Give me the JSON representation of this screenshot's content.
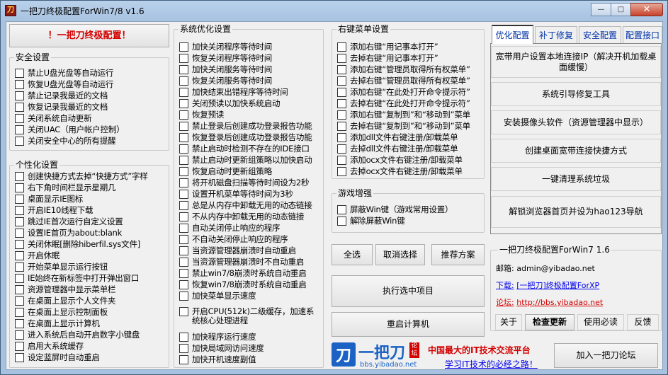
{
  "window": {
    "title": "一把刀终极配置ForWin7/8 v1.6",
    "app_icon_glyph": "刀",
    "minimize": "—",
    "maximize": "□",
    "close": "✕"
  },
  "left": {
    "top_button": "！一把刀终极配置！",
    "security": {
      "title": "安全设置",
      "items": [
        "禁止U盘光盘等自动运行",
        "恢复U盘光盘等自动运行",
        "禁止记录我最近的文档",
        "恢复记录我最近的文档",
        "关闭系统自动更新",
        "关闭UAC（用户帐户控制）",
        "关闭安全中心的所有提醒"
      ]
    },
    "personal": {
      "title": "个性化设置",
      "items": [
        "创建快捷方式去掉“快捷方式”字样",
        "右下角时间栏显示星期几",
        "桌面显示IE图标",
        "开启IE10线程下载",
        "跳过IE首次运行自定义设置",
        "设置IE首页为about:blank",
        "关闭休眠[删除hiberfil.sys文件]",
        "开启休眠",
        "开始菜单显示运行按钮",
        "IE始终在新标签中打开弹出窗口",
        "资源管理器中显示菜单栏",
        "在桌面上显示个人文件夹",
        "在桌面上显示控制面板",
        "在桌面上显示计算机",
        "进入系统后自动开启数字小键盘",
        "启用大系统缓存",
        "设定蓝屏时自动重启"
      ]
    }
  },
  "middle": {
    "title": "系统优化设置",
    "items": [
      "加快关闭程序等待时间",
      "恢复关闭程序等待时间",
      "加快关闭服务等待时间",
      "恢复关闭服务等待时间",
      "加快结束出错程序等待时间",
      "关闭预读以加快系统启动",
      "恢复预读",
      "禁止登录后创建成功登录报告功能",
      "恢复登录后创建成功登录报告功能",
      "禁止启动时检测不存在的IDE接口",
      "禁止启动时更新组策略以加快启动",
      "恢复启动时更新组策略",
      "将开机磁盘扫描等待时间设为2秒",
      "设置开机菜单等待时间为3秒",
      "总是从内存中卸载无用的动态链接",
      "不从内存中卸载无用的动态链接",
      "自动关闭停止响应的程序",
      "不自动关闭停止响应的程序",
      "当资源管理器崩溃时自动重启",
      "当资源管理器崩溃时不自动重启",
      "禁止win7/8崩溃时系统自动重启",
      "恢复win7/8崩溃时系统自动重启",
      "加快菜单显示速度"
    ],
    "cpu_item": "开启CPU(512k)二级缓存，加速系统核心处理进程",
    "items2": [
      "加快程序运行速度",
      "加快局域网访问速度",
      "加快开机速度副值"
    ]
  },
  "context": {
    "title": "右键菜单设置",
    "items": [
      "添加右键“用记事本打开”",
      "去掉右键“用记事本打开”",
      "添加右键“管理员取得所有权菜单”",
      "去掉右键“管理员取得所有权菜单”",
      "添加右键“在此处打开命令提示符”",
      "去掉右键“在此处打开命令提示符”",
      "添加右键“复制到”和“移动到”菜单",
      "去掉右键“复制到”和“移动到”菜单",
      "添加dll文件右键注册/卸载菜单",
      "去掉dll文件右键注册/卸载菜单",
      "添加ocx文件右键注册/卸载菜单",
      "去掉ocx文件右键注册/卸载菜单"
    ]
  },
  "game": {
    "title": "游戏增强",
    "items": [
      "屏蔽Win键（游戏常用设置）",
      "解除屏蔽Win键"
    ]
  },
  "actions": {
    "select_all": "全选",
    "deselect": "取消选择",
    "recommend": "推荐方案",
    "execute": "执行选中项目",
    "restart": "重启计算机"
  },
  "tabs": [
    "优化配置",
    "补丁修复",
    "安全配置",
    "配置接口"
  ],
  "tools": [
    "宽带用户设置本地连接IP（解决开机加载桌面缓慢）",
    "系统引导修复工具",
    "安装摄像头软件（资源管理器中显示）",
    "创建桌面宽带连接快捷方式",
    "一键清理系统垃圾",
    "解锁浏览器首页并设为hao123导航"
  ],
  "about": {
    "title": "一把刀终极配置ForWin7 1.6",
    "email_label": "邮箱:",
    "email": "admin@yibadao.net",
    "download_label": "下载:",
    "download_link": "[一把刀]终极配置ForXP",
    "forum_label": "论坛:",
    "forum_link": "http://bbs.yibadao.net",
    "buttons": [
      "关于",
      "检查更新",
      "使用必读",
      "反馈"
    ]
  },
  "banner": {
    "logo_char": "刀",
    "brand": "一把刀",
    "badge": "论坛",
    "url": "bbs.yibadao.net",
    "slogan": "中国最大的IT技术交流平台",
    "slogan2": "学习IT技术的必经之路！",
    "join": "加入一把刀论坛"
  },
  "colors": {
    "accent_red": "#d40000",
    "link_blue": "#0000ee",
    "title_bar": "#b9d1ea"
  }
}
